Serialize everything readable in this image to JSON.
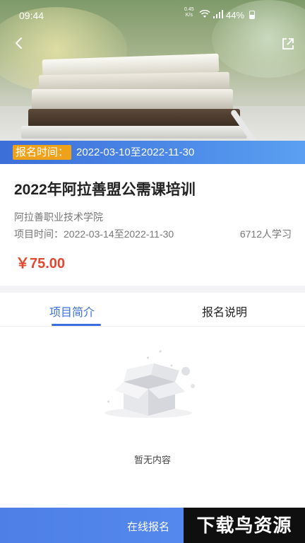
{
  "status_bar": {
    "time": "09:44",
    "net_speed_value": "0.45",
    "net_speed_unit": "K/s",
    "battery": "44%"
  },
  "banner": {
    "registration_label": "报名时间：",
    "registration_dates": "2022-03-10至2022-11-30"
  },
  "course": {
    "title": "2022年阿拉善盟公需课培训",
    "organization": "阿拉善职业技术学院",
    "period": "项目时间：2022-03-14至2022-11-30",
    "learners": "6712人学习",
    "price": "￥75.00"
  },
  "tabs": [
    {
      "label": "项目简介",
      "active": true
    },
    {
      "label": "报名说明",
      "active": false
    }
  ],
  "empty_state": {
    "text": "暂无内容"
  },
  "bottom_bar": {
    "enroll_label": "在线报名"
  },
  "watermark": {
    "text": "下载鸟资源"
  },
  "colors": {
    "accent": "#3a6fe0",
    "price": "#e2482f",
    "badge": "#f0a11a"
  },
  "icons": [
    "back-arrow-icon",
    "share-icon",
    "wifi-icon",
    "signal-icon",
    "battery-icon",
    "empty-box-icon"
  ]
}
